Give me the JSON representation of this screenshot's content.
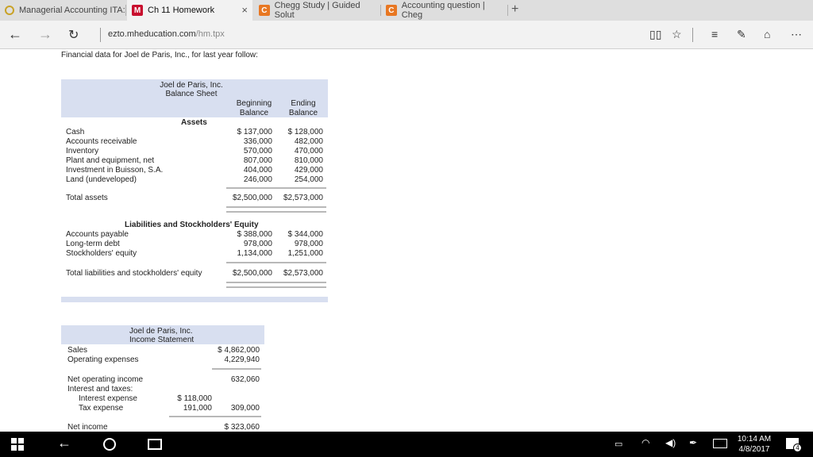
{
  "tabs": [
    {
      "label": "Managerial Accounting ITA:",
      "icon": "spinner-icon"
    },
    {
      "label": "Ch 11 Homework",
      "icon": "M",
      "close": "×"
    },
    {
      "label": "Chegg Study | Guided Solut",
      "icon": "C"
    },
    {
      "label": "Accounting question | Cheg",
      "icon": "C"
    }
  ],
  "new_tab": "+",
  "address": {
    "domain": "ezto.mheducation.com",
    "path": "/hm.tpx"
  },
  "intro": "Financial data for Joel de Paris, Inc., for last year follow:",
  "balance_sheet": {
    "company": "Joel de Paris, Inc.",
    "title": "Balance Sheet",
    "col_begin": [
      "Beginning",
      "Balance"
    ],
    "col_end": [
      "Ending",
      "Balance"
    ],
    "assets_heading": "Assets",
    "assets": [
      {
        "label": "Cash",
        "begin": "$  137,000",
        "end": "$  128,000"
      },
      {
        "label": "Accounts receivable",
        "begin": "336,000",
        "end": "482,000"
      },
      {
        "label": "Inventory",
        "begin": "570,000",
        "end": "470,000"
      },
      {
        "label": "Plant and equipment, net",
        "begin": "807,000",
        "end": "810,000"
      },
      {
        "label": "Investment in Buisson, S.A.",
        "begin": "404,000",
        "end": "429,000"
      },
      {
        "label": "Land (undeveloped)",
        "begin": "246,000",
        "end": "254,000"
      }
    ],
    "total_assets": {
      "label": "Total assets",
      "begin": "$2,500,000",
      "end": "$2,573,000"
    },
    "liab_heading": "Liabilities and Stockholders' Equity",
    "liabilities": [
      {
        "label": "Accounts payable",
        "begin": "$  388,000",
        "end": "$  344,000"
      },
      {
        "label": "Long-term debt",
        "begin": "978,000",
        "end": "978,000"
      },
      {
        "label": "Stockholders' equity",
        "begin": "1,134,000",
        "end": "1,251,000"
      }
    ],
    "total_liab": {
      "label": "Total liabilities and stockholders' equity",
      "begin": "$2,500,000",
      "end": "$2,573,000"
    }
  },
  "income_statement": {
    "company": "Joel de Paris, Inc.",
    "title": "Income Statement",
    "sales": {
      "label": "Sales",
      "value": "$ 4,862,000"
    },
    "opex": {
      "label": "Operating expenses",
      "value": "4,229,940"
    },
    "noi": {
      "label": "Net operating income",
      "value": "632,060"
    },
    "int_tax": {
      "label": "Interest and taxes:"
    },
    "interest": {
      "label": "Interest expense",
      "value": "$ 118,000"
    },
    "tax": {
      "label": "Tax expense",
      "value": "191,000",
      "total": "309,000"
    },
    "net": {
      "label": "Net income",
      "value": "$   323,060"
    }
  },
  "taskbar": {
    "time": "10:14 AM",
    "date": "4/8/2017",
    "notif_count": "4"
  }
}
